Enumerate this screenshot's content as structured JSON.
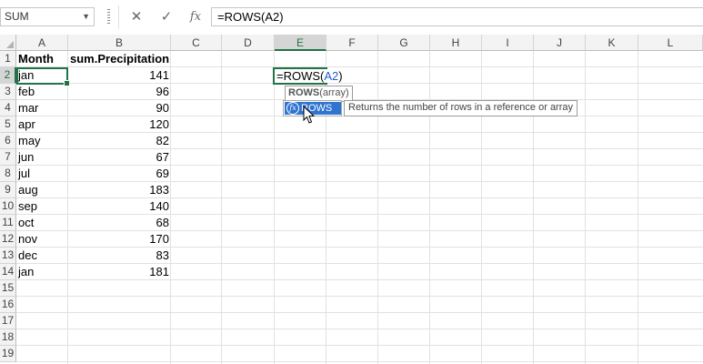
{
  "name_box": {
    "value": "SUM"
  },
  "formula_bar": {
    "cancel_icon": "✕",
    "enter_icon": "✓",
    "fx_label": "fx",
    "formula": "=ROWS(A2)"
  },
  "columns": [
    "A",
    "B",
    "C",
    "D",
    "E",
    "F",
    "G",
    "H",
    "I",
    "J",
    "K",
    "L"
  ],
  "rows": [
    "1",
    "2",
    "3",
    "4",
    "5",
    "6",
    "7",
    "8",
    "9",
    "10",
    "11",
    "12",
    "13",
    "14",
    "15",
    "16",
    "17",
    "18",
    "19"
  ],
  "sheet": {
    "header": {
      "month": "Month",
      "precip": "sum.Precipitation"
    },
    "data": [
      {
        "month": "jan",
        "value": "141"
      },
      {
        "month": "feb",
        "value": "96"
      },
      {
        "month": "mar",
        "value": "90"
      },
      {
        "month": "apr",
        "value": "120"
      },
      {
        "month": "may",
        "value": "82"
      },
      {
        "month": "jun",
        "value": "67"
      },
      {
        "month": "jul",
        "value": "69"
      },
      {
        "month": "aug",
        "value": "183"
      },
      {
        "month": "sep",
        "value": "140"
      },
      {
        "month": "oct",
        "value": "68"
      },
      {
        "month": "nov",
        "value": "170"
      },
      {
        "month": "dec",
        "value": "83"
      },
      {
        "month": "jan",
        "value": "181"
      }
    ]
  },
  "edit_cell": {
    "prefix": "=ROWS(",
    "ref": "A2",
    "suffix": ")"
  },
  "tooltip": {
    "func": "ROWS",
    "args": "(array)"
  },
  "autocomplete": {
    "item": "ROWS",
    "description": "Returns the number of rows in a reference or array"
  },
  "colors": {
    "accent": "#217346",
    "highlight": "#2f74d0",
    "ref": "#1f5fd0"
  }
}
